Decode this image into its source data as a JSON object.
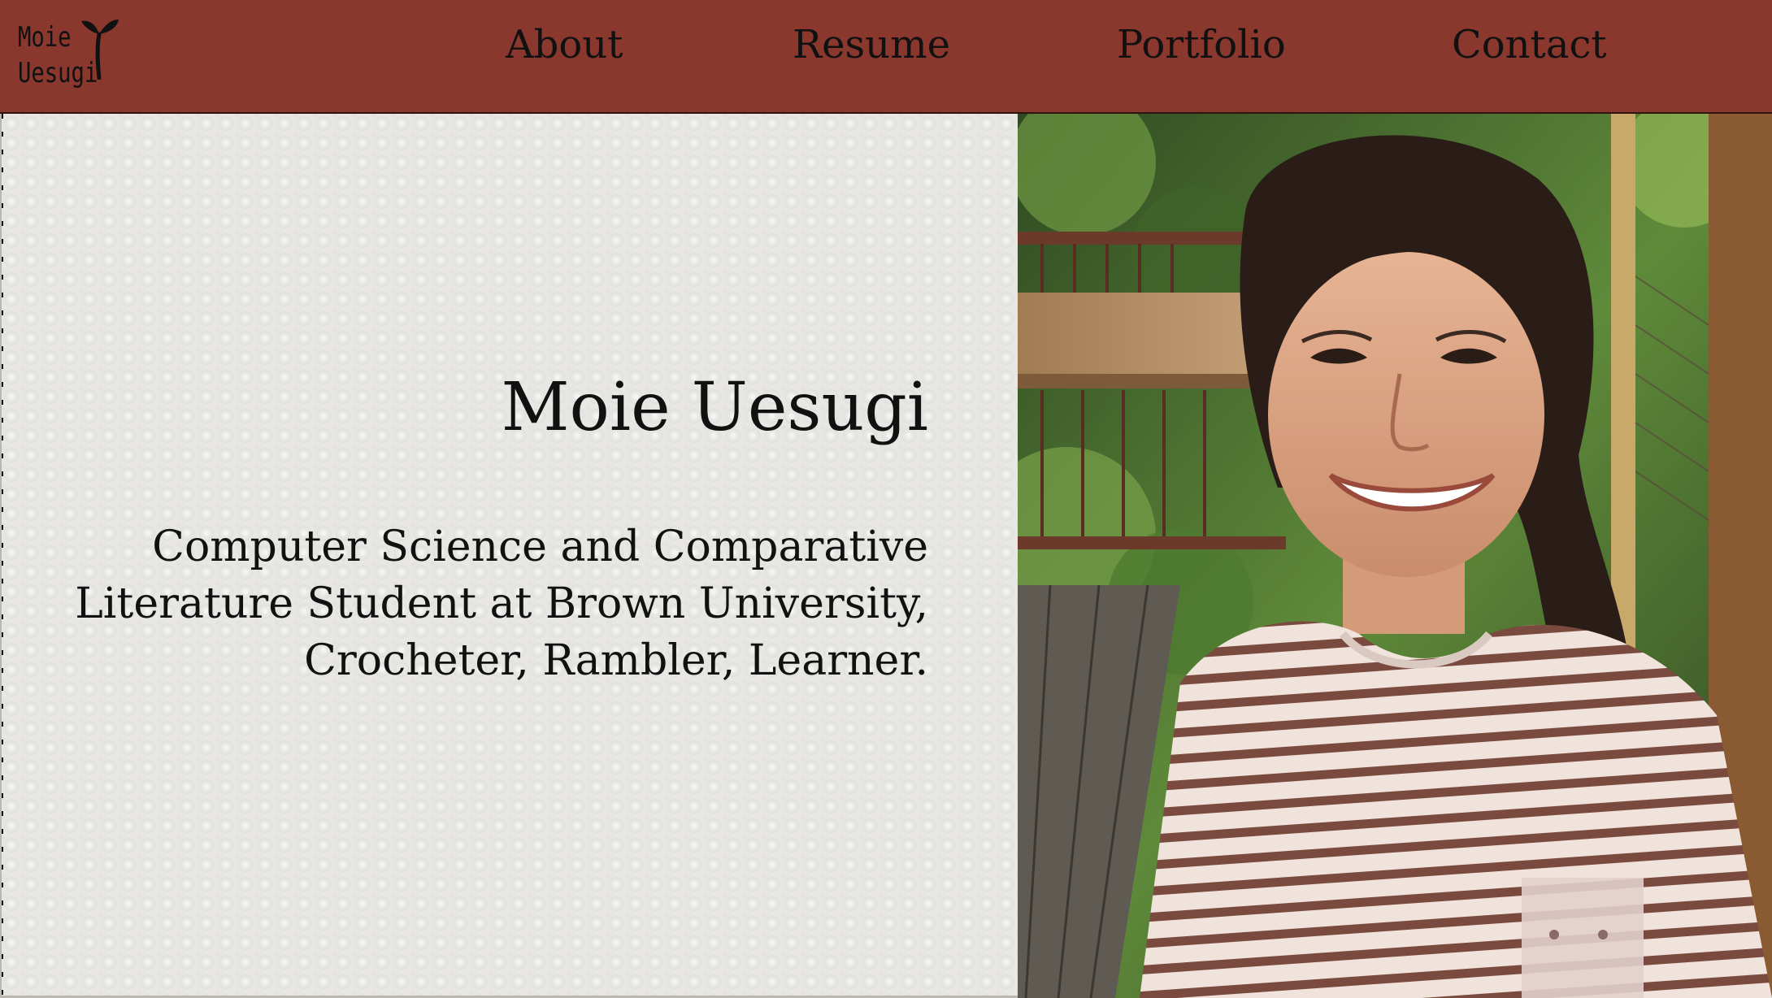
{
  "logo": {
    "line1": "Moie",
    "line2": "Uesugi",
    "icon": "sprout-icon"
  },
  "nav": {
    "items": [
      {
        "label": "About"
      },
      {
        "label": "Resume"
      },
      {
        "label": "Portfolio"
      },
      {
        "label": "Contact"
      }
    ]
  },
  "hero": {
    "name": "Moie Uesugi",
    "tagline_lines": [
      "Computer Science and Comparative",
      "Literature Student at Brown University,",
      "Crocheter, Rambler, Learner."
    ]
  },
  "photo": {
    "subject": "portrait-photo"
  },
  "colors": {
    "header_bg": "#8a372e",
    "panel_bg": "#e8e7e4",
    "text": "#111111"
  }
}
